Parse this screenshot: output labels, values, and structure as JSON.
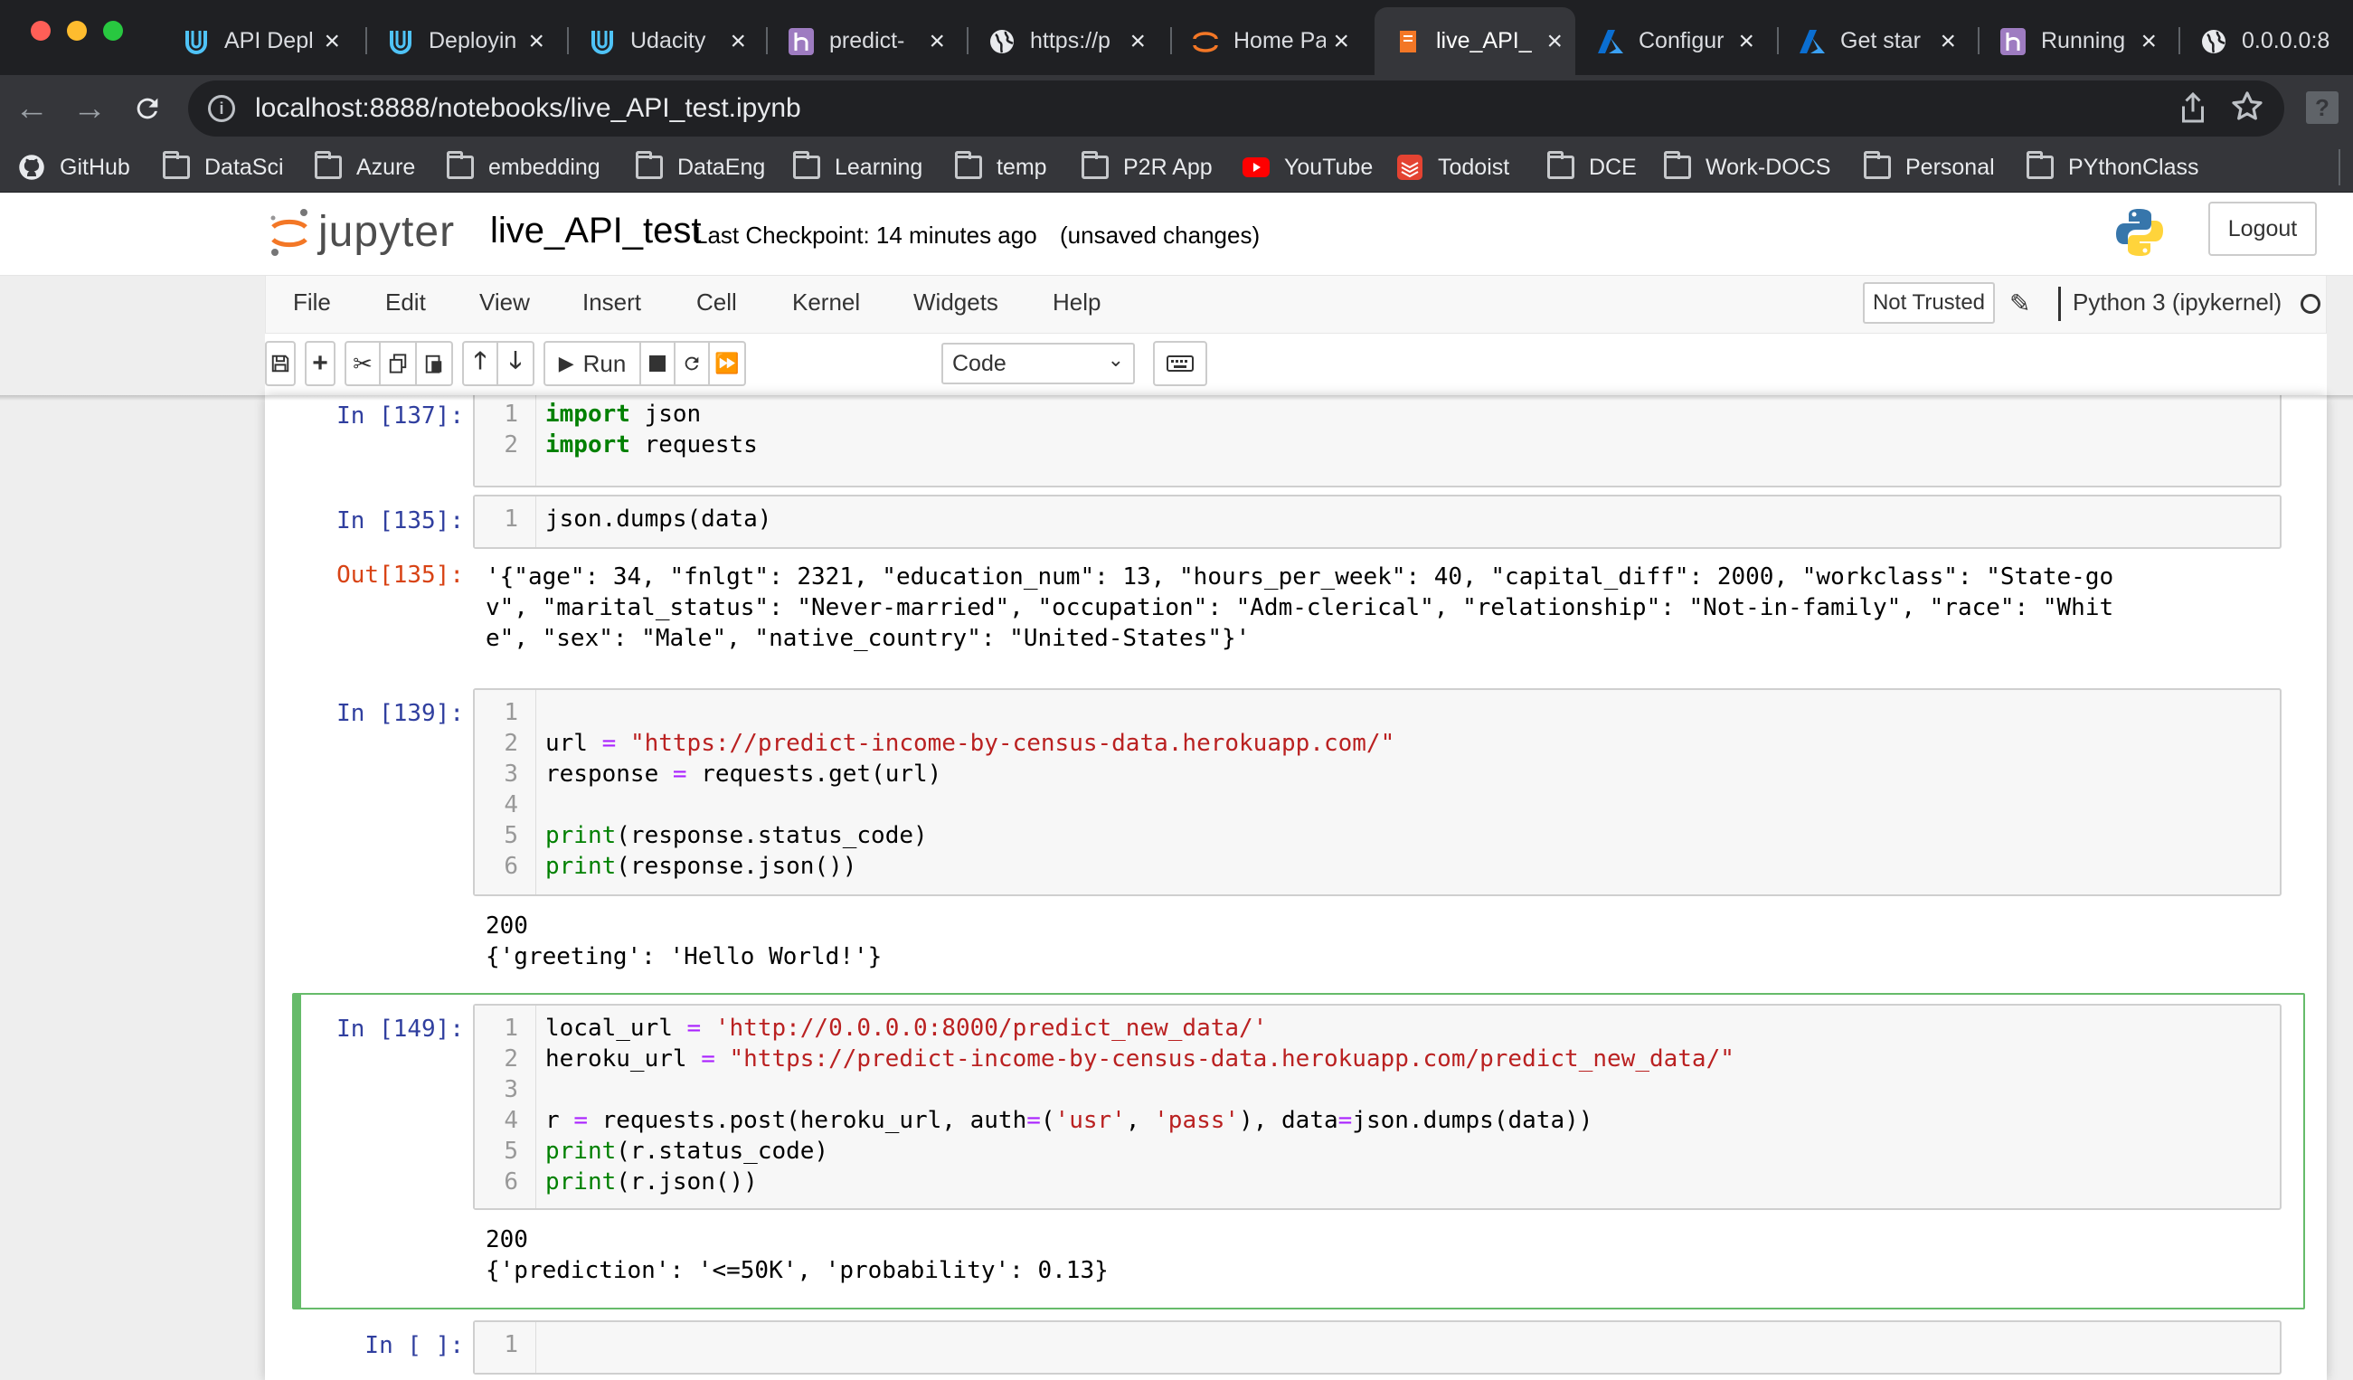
{
  "browser": {
    "tabs": [
      {
        "title": "API Depl",
        "icon": "udacity-icon"
      },
      {
        "title": "Deployin",
        "icon": "udacity-icon"
      },
      {
        "title": "Udacity",
        "icon": "udacity-icon"
      },
      {
        "title": "predict-",
        "icon": "heroku-icon"
      },
      {
        "title": "https://p",
        "icon": "globe-icon"
      },
      {
        "title": "Home Pa",
        "icon": "jupyter-icon"
      },
      {
        "title": "live_API_",
        "icon": "notebook-icon"
      },
      {
        "title": "Configur",
        "icon": "azure-icon"
      },
      {
        "title": "Get star",
        "icon": "azure-icon"
      },
      {
        "title": "Running",
        "icon": "heroku-icon"
      },
      {
        "title": "0.0.0.0:8",
        "icon": "globe-icon"
      }
    ],
    "address": "localhost:8888/notebooks/live_API_test.ipynb",
    "bookmarks": [
      {
        "label": "GitHub",
        "icon": "github-icon"
      },
      {
        "label": "DataSci",
        "icon": "folder-icon"
      },
      {
        "label": "Azure",
        "icon": "folder-icon"
      },
      {
        "label": "embedding",
        "icon": "folder-icon"
      },
      {
        "label": "DataEng",
        "icon": "folder-icon"
      },
      {
        "label": "Learning",
        "icon": "folder-icon"
      },
      {
        "label": "temp",
        "icon": "folder-icon"
      },
      {
        "label": "P2R App",
        "icon": "folder-icon"
      },
      {
        "label": "YouTube",
        "icon": "youtube-icon"
      },
      {
        "label": "Todoist",
        "icon": "todoist-icon"
      },
      {
        "label": "DCE",
        "icon": "folder-icon"
      },
      {
        "label": "Work-DOCS",
        "icon": "folder-icon"
      },
      {
        "label": "Personal",
        "icon": "folder-icon"
      },
      {
        "label": "PYthonClass",
        "icon": "folder-icon"
      }
    ]
  },
  "jupyter": {
    "logo_text": "jupyter",
    "notebook_name": "live_API_test",
    "checkpoint": "Last Checkpoint: 14 minutes ago",
    "unsaved": "(unsaved changes)",
    "logout": "Logout",
    "menu": [
      "File",
      "Edit",
      "View",
      "Insert",
      "Cell",
      "Kernel",
      "Widgets",
      "Help"
    ],
    "not_trusted": "Not Trusted",
    "kernel": "Python 3 (ipykernel)",
    "run_label": "Run",
    "cell_type": "Code"
  },
  "cells": {
    "c1": {
      "prompt": "In [137]:",
      "lines": [
        [
          [
            "kw",
            "import"
          ],
          [
            "txt",
            " json"
          ]
        ],
        [
          [
            "kw",
            "import"
          ],
          [
            "txt",
            " requests"
          ]
        ]
      ]
    },
    "c2": {
      "prompt": "In [135]:",
      "lines": [
        [
          [
            "txt",
            "json.dumps(data)"
          ]
        ]
      ],
      "out_prompt": "Out[135]:",
      "output": "'{\"age\": 34, \"fnlgt\": 2321, \"education_num\": 13, \"hours_per_week\": 40, \"capital_diff\": 2000, \"workclass\": \"State-go\nv\", \"marital_status\": \"Never-married\", \"occupation\": \"Adm-clerical\", \"relationship\": \"Not-in-family\", \"race\": \"Whit\ne\", \"sex\": \"Male\", \"native_country\": \"United-States\"}'"
    },
    "c3": {
      "prompt": "In [139]:",
      "lines": [
        [],
        [
          [
            "txt",
            "url "
          ],
          [
            "op",
            "="
          ],
          [
            "txt",
            " "
          ],
          [
            "str",
            "\"https://predict-income-by-census-data.herokuapp.com/\""
          ]
        ],
        [
          [
            "txt",
            "response "
          ],
          [
            "op",
            "="
          ],
          [
            "txt",
            " requests.get(url)"
          ]
        ],
        [],
        [
          [
            "fn",
            "print"
          ],
          [
            "txt",
            "(response.status_code)"
          ]
        ],
        [
          [
            "fn",
            "print"
          ],
          [
            "txt",
            "(response.json())"
          ]
        ]
      ],
      "output": "200\n{'greeting': 'Hello World!'}"
    },
    "c4": {
      "prompt": "In [149]:",
      "lines": [
        [
          [
            "txt",
            "local_url "
          ],
          [
            "op",
            "="
          ],
          [
            "txt",
            " "
          ],
          [
            "str",
            "'http://0.0.0.0:8000/predict_new_data/'"
          ]
        ],
        [
          [
            "txt",
            "heroku_url "
          ],
          [
            "op",
            "="
          ],
          [
            "txt",
            " "
          ],
          [
            "str",
            "\"https://predict-income-by-census-data.herokuapp.com/predict_new_data/\""
          ]
        ],
        [],
        [
          [
            "txt",
            "r "
          ],
          [
            "op",
            "="
          ],
          [
            "txt",
            " requests.post(heroku_url, auth"
          ],
          [
            "op",
            "="
          ],
          [
            "txt",
            "("
          ],
          [
            "str",
            "'usr'"
          ],
          [
            "txt",
            ", "
          ],
          [
            "str",
            "'pass'"
          ],
          [
            "txt",
            "), data"
          ],
          [
            "op",
            "="
          ],
          [
            "txt",
            "json.dumps(data))"
          ]
        ],
        [
          [
            "fn",
            "print"
          ],
          [
            "txt",
            "(r.status_code)"
          ]
        ],
        [
          [
            "fn",
            "print"
          ],
          [
            "txt",
            "(r.json())"
          ]
        ]
      ],
      "output": "200\n{'prediction': '<=50K', 'probability': 0.13}"
    },
    "c5": {
      "prompt": "In [ ]:",
      "lines": [
        []
      ]
    }
  }
}
